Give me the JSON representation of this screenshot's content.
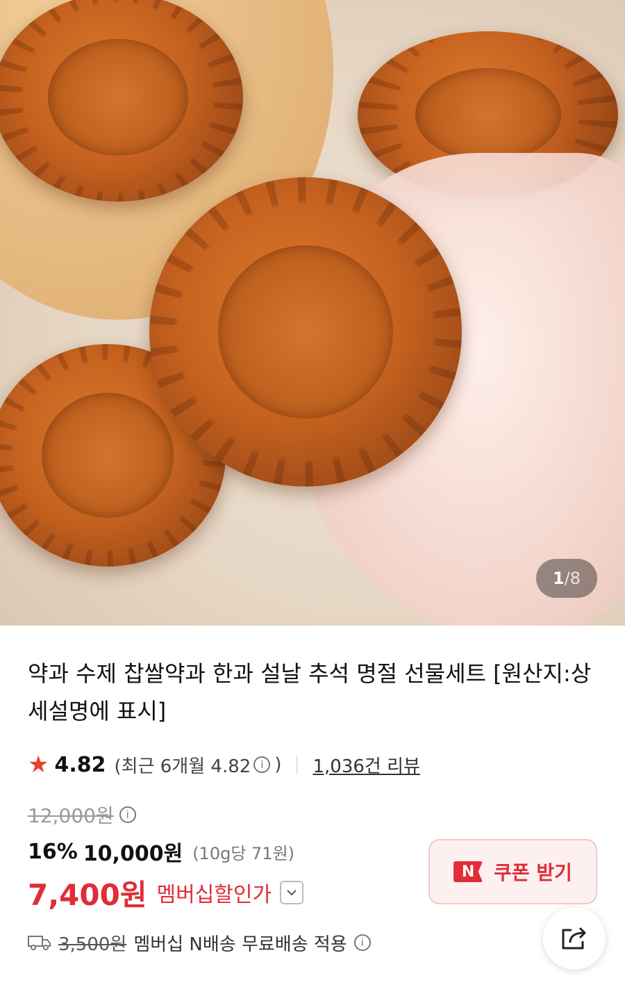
{
  "gallery": {
    "current_page": "1",
    "separator": "/",
    "total_pages": "8"
  },
  "product": {
    "title": "약과 수제 찹쌀약과 한과 설날 추석 명절 선물세트 [원산지:상세설명에 표시]"
  },
  "rating": {
    "icon": "star-icon",
    "score": "4.82",
    "recent_open": "(최근 6개월 4.82",
    "recent_close": ")",
    "review_count": "1,036건 리뷰"
  },
  "price": {
    "original": "12,000원",
    "discount_rate": "16%",
    "discount_price": "10,000원",
    "unit_price": "(10g당 71원)",
    "member_price": "7,400원",
    "member_label": "멤버십할인가"
  },
  "coupon": {
    "badge": "N",
    "label": "쿠폰 받기"
  },
  "shipping": {
    "original_fee": "3,500원",
    "description": "멤버십 N배송 무료배송 적용"
  },
  "colors": {
    "accent_red": "#e02d37",
    "star": "#e8432f"
  }
}
